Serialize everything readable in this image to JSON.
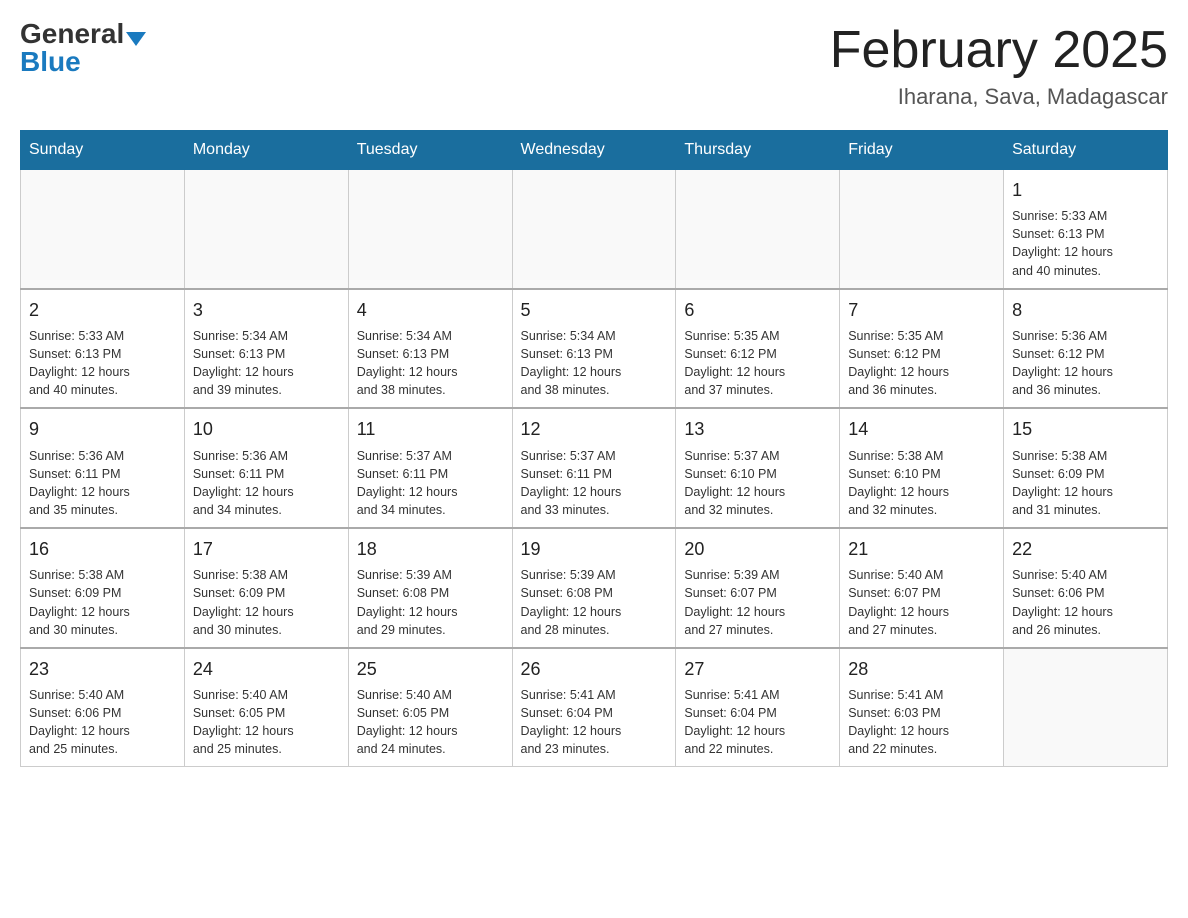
{
  "header": {
    "logo_general": "General",
    "logo_blue": "Blue",
    "month_title": "February 2025",
    "location": "Iharana, Sava, Madagascar"
  },
  "days_of_week": [
    "Sunday",
    "Monday",
    "Tuesday",
    "Wednesday",
    "Thursday",
    "Friday",
    "Saturday"
  ],
  "weeks": [
    [
      {
        "day": "",
        "info": ""
      },
      {
        "day": "",
        "info": ""
      },
      {
        "day": "",
        "info": ""
      },
      {
        "day": "",
        "info": ""
      },
      {
        "day": "",
        "info": ""
      },
      {
        "day": "",
        "info": ""
      },
      {
        "day": "1",
        "info": "Sunrise: 5:33 AM\nSunset: 6:13 PM\nDaylight: 12 hours\nand 40 minutes."
      }
    ],
    [
      {
        "day": "2",
        "info": "Sunrise: 5:33 AM\nSunset: 6:13 PM\nDaylight: 12 hours\nand 40 minutes."
      },
      {
        "day": "3",
        "info": "Sunrise: 5:34 AM\nSunset: 6:13 PM\nDaylight: 12 hours\nand 39 minutes."
      },
      {
        "day": "4",
        "info": "Sunrise: 5:34 AM\nSunset: 6:13 PM\nDaylight: 12 hours\nand 38 minutes."
      },
      {
        "day": "5",
        "info": "Sunrise: 5:34 AM\nSunset: 6:13 PM\nDaylight: 12 hours\nand 38 minutes."
      },
      {
        "day": "6",
        "info": "Sunrise: 5:35 AM\nSunset: 6:12 PM\nDaylight: 12 hours\nand 37 minutes."
      },
      {
        "day": "7",
        "info": "Sunrise: 5:35 AM\nSunset: 6:12 PM\nDaylight: 12 hours\nand 36 minutes."
      },
      {
        "day": "8",
        "info": "Sunrise: 5:36 AM\nSunset: 6:12 PM\nDaylight: 12 hours\nand 36 minutes."
      }
    ],
    [
      {
        "day": "9",
        "info": "Sunrise: 5:36 AM\nSunset: 6:11 PM\nDaylight: 12 hours\nand 35 minutes."
      },
      {
        "day": "10",
        "info": "Sunrise: 5:36 AM\nSunset: 6:11 PM\nDaylight: 12 hours\nand 34 minutes."
      },
      {
        "day": "11",
        "info": "Sunrise: 5:37 AM\nSunset: 6:11 PM\nDaylight: 12 hours\nand 34 minutes."
      },
      {
        "day": "12",
        "info": "Sunrise: 5:37 AM\nSunset: 6:11 PM\nDaylight: 12 hours\nand 33 minutes."
      },
      {
        "day": "13",
        "info": "Sunrise: 5:37 AM\nSunset: 6:10 PM\nDaylight: 12 hours\nand 32 minutes."
      },
      {
        "day": "14",
        "info": "Sunrise: 5:38 AM\nSunset: 6:10 PM\nDaylight: 12 hours\nand 32 minutes."
      },
      {
        "day": "15",
        "info": "Sunrise: 5:38 AM\nSunset: 6:09 PM\nDaylight: 12 hours\nand 31 minutes."
      }
    ],
    [
      {
        "day": "16",
        "info": "Sunrise: 5:38 AM\nSunset: 6:09 PM\nDaylight: 12 hours\nand 30 minutes."
      },
      {
        "day": "17",
        "info": "Sunrise: 5:38 AM\nSunset: 6:09 PM\nDaylight: 12 hours\nand 30 minutes."
      },
      {
        "day": "18",
        "info": "Sunrise: 5:39 AM\nSunset: 6:08 PM\nDaylight: 12 hours\nand 29 minutes."
      },
      {
        "day": "19",
        "info": "Sunrise: 5:39 AM\nSunset: 6:08 PM\nDaylight: 12 hours\nand 28 minutes."
      },
      {
        "day": "20",
        "info": "Sunrise: 5:39 AM\nSunset: 6:07 PM\nDaylight: 12 hours\nand 27 minutes."
      },
      {
        "day": "21",
        "info": "Sunrise: 5:40 AM\nSunset: 6:07 PM\nDaylight: 12 hours\nand 27 minutes."
      },
      {
        "day": "22",
        "info": "Sunrise: 5:40 AM\nSunset: 6:06 PM\nDaylight: 12 hours\nand 26 minutes."
      }
    ],
    [
      {
        "day": "23",
        "info": "Sunrise: 5:40 AM\nSunset: 6:06 PM\nDaylight: 12 hours\nand 25 minutes."
      },
      {
        "day": "24",
        "info": "Sunrise: 5:40 AM\nSunset: 6:05 PM\nDaylight: 12 hours\nand 25 minutes."
      },
      {
        "day": "25",
        "info": "Sunrise: 5:40 AM\nSunset: 6:05 PM\nDaylight: 12 hours\nand 24 minutes."
      },
      {
        "day": "26",
        "info": "Sunrise: 5:41 AM\nSunset: 6:04 PM\nDaylight: 12 hours\nand 23 minutes."
      },
      {
        "day": "27",
        "info": "Sunrise: 5:41 AM\nSunset: 6:04 PM\nDaylight: 12 hours\nand 22 minutes."
      },
      {
        "day": "28",
        "info": "Sunrise: 5:41 AM\nSunset: 6:03 PM\nDaylight: 12 hours\nand 22 minutes."
      },
      {
        "day": "",
        "info": ""
      }
    ]
  ]
}
